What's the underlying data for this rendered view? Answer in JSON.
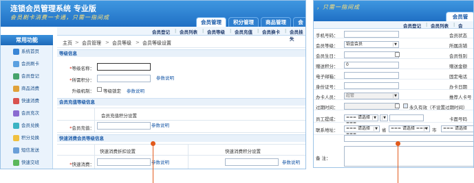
{
  "panel_a": {
    "app_title": "连锁会员管理系统 专业版",
    "slogan": "会员刷卡消费一卡通，只需一指间成",
    "tabs": [
      "会员管理",
      "积分管理",
      "商品管理",
      "会"
    ],
    "subnav": [
      "会员登记",
      "会员列表",
      "会员等级",
      "会员充值",
      "会员换卡",
      "会员挂失"
    ],
    "sidebar": {
      "heading": "常用功能",
      "items": [
        "系统首页",
        "会员刷卡",
        "会员登记",
        "商品消费",
        "快速消费",
        "会员充次",
        "会员兑换",
        "积分兑换",
        "短信发送",
        "快速交班"
      ]
    },
    "breadcrumb": [
      "主页",
      "会员管理",
      "会员等级",
      "会员等级设置"
    ],
    "level_section": {
      "heading": "等级信息",
      "name_label": "等级名称：",
      "points_label": "所需积分：",
      "points_help": "参数说明",
      "upgrade_label": "升级机制：",
      "lock_label": "等级锁定",
      "lock_help": "参数说明"
    },
    "recharge_section": {
      "heading": "会员充值等级信息",
      "header": "会员充值积分设置",
      "recharge_label": "会员充值：",
      "recharge_help": "参数说明"
    },
    "quick_section": {
      "heading": "快速消费会员等级信息",
      "discount_header": "快速消费折扣设置",
      "points_header": "快速消费积分设置",
      "quick_label": "快速消费：",
      "discount_help": "参数说明",
      "points_help": "参数说明"
    }
  },
  "panel_b": {
    "slogan": "，只需一指间成",
    "tab": "会员管",
    "subnav": [
      "会员登记",
      "会员列表",
      "会"
    ],
    "rows": [
      {
        "label": "手机号码：",
        "value": "",
        "right": "会员状态"
      },
      {
        "label": "会员等级：",
        "value": "铂金会员",
        "right": "所属店铺"
      },
      {
        "label": "会员生日：",
        "value": "",
        "right": "会员性别"
      },
      {
        "label": "赠送积分：",
        "value": "0",
        "right": "赠送金额"
      },
      {
        "label": "电子邮箱：",
        "value": "",
        "right": "固定电话"
      },
      {
        "label": "身份证号：",
        "value": "",
        "right": "办卡日期"
      },
      {
        "label": "办卡人员：",
        "value": "超管",
        "right": "推荐人卡号"
      },
      {
        "label": "过期时间：",
        "value": "",
        "right": ""
      },
      {
        "label": "员工提成：",
        "value": "=== 请选择 ===",
        "right": "卡面号码"
      },
      {
        "label": "联系地址：",
        "value": "=== 请选择 ===",
        "right": ""
      },
      {
        "label": "备  注：",
        "value": "",
        "right": ""
      }
    ],
    "forever_label": "永久有效（不设置过期时间）",
    "province_label": "省",
    "city_select": "=== 请选择 ===",
    "city_label": "市",
    "district_select": "=== 请选择"
  },
  "colors": {
    "brand_blue": "#1f6fc4",
    "accent_orange": "#e25a1c",
    "required_red": "#d81e06"
  }
}
